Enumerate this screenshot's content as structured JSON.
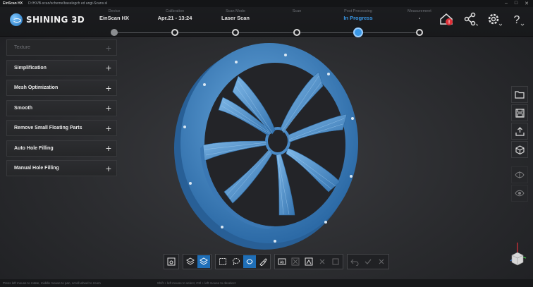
{
  "window": {
    "app_name": "EinScan HX",
    "path": "D:/HX/B-scan/scheme/baselegch ed angt-Scans.sl"
  },
  "brand": {
    "logo_text": "SHINING 3D",
    "accent": "#3a98e6"
  },
  "workflow": {
    "steps": [
      {
        "label": "Device",
        "value": "EinScan HX",
        "state": "done"
      },
      {
        "label": "Calibration",
        "value": "Apr.21 - 13:24",
        "state": "done"
      },
      {
        "label": "Scan Mode",
        "value": "Laser Scan",
        "state": "done"
      },
      {
        "label": "Scan",
        "value": "",
        "state": "done"
      },
      {
        "label": "Post Processing",
        "value": "In Progress",
        "state": "active"
      },
      {
        "label": "Measurement",
        "value": "-",
        "state": "pending"
      }
    ]
  },
  "header_icons": [
    "home-alert-icon",
    "share-icon",
    "settings-icon",
    "help-icon"
  ],
  "left_panel": {
    "items": [
      {
        "label": "Texture",
        "enabled": false
      },
      {
        "label": "Simplification",
        "enabled": true
      },
      {
        "label": "Mesh Optimization",
        "enabled": true
      },
      {
        "label": "Smooth",
        "enabled": true
      },
      {
        "label": "Remove Small Floating Parts",
        "enabled": true
      },
      {
        "label": "Auto Hole Filling",
        "enabled": true
      },
      {
        "label": "Manual Hole Filling",
        "enabled": true
      }
    ]
  },
  "right_toolbar": [
    "folder-icon",
    "save-icon",
    "export-icon",
    "cube-view-icon"
  ],
  "right_toolbar2": [
    "visibility-toggle-icon",
    "eye-icon"
  ],
  "bottom_toolbar": {
    "groups": [
      [
        "screenshot-icon"
      ],
      [
        "layers-icon",
        "mesh-view-icon"
      ],
      [
        "rect-select-icon",
        "lasso-select-icon",
        "brush-select-icon",
        "paint-icon"
      ],
      [
        "invert-select-icon",
        "clear-select-icon",
        "select-connected-icon",
        "delete-icon",
        "undo-delete-icon"
      ],
      [
        "undo-icon",
        "apply-icon",
        "cancel-icon"
      ]
    ]
  },
  "status": {
    "left": "Press left mouse to rotate, middle mouse to pan, scroll wheel to zoom",
    "mid": "Shift + left mouse to select, Ctrl + left mouse to deselect"
  }
}
